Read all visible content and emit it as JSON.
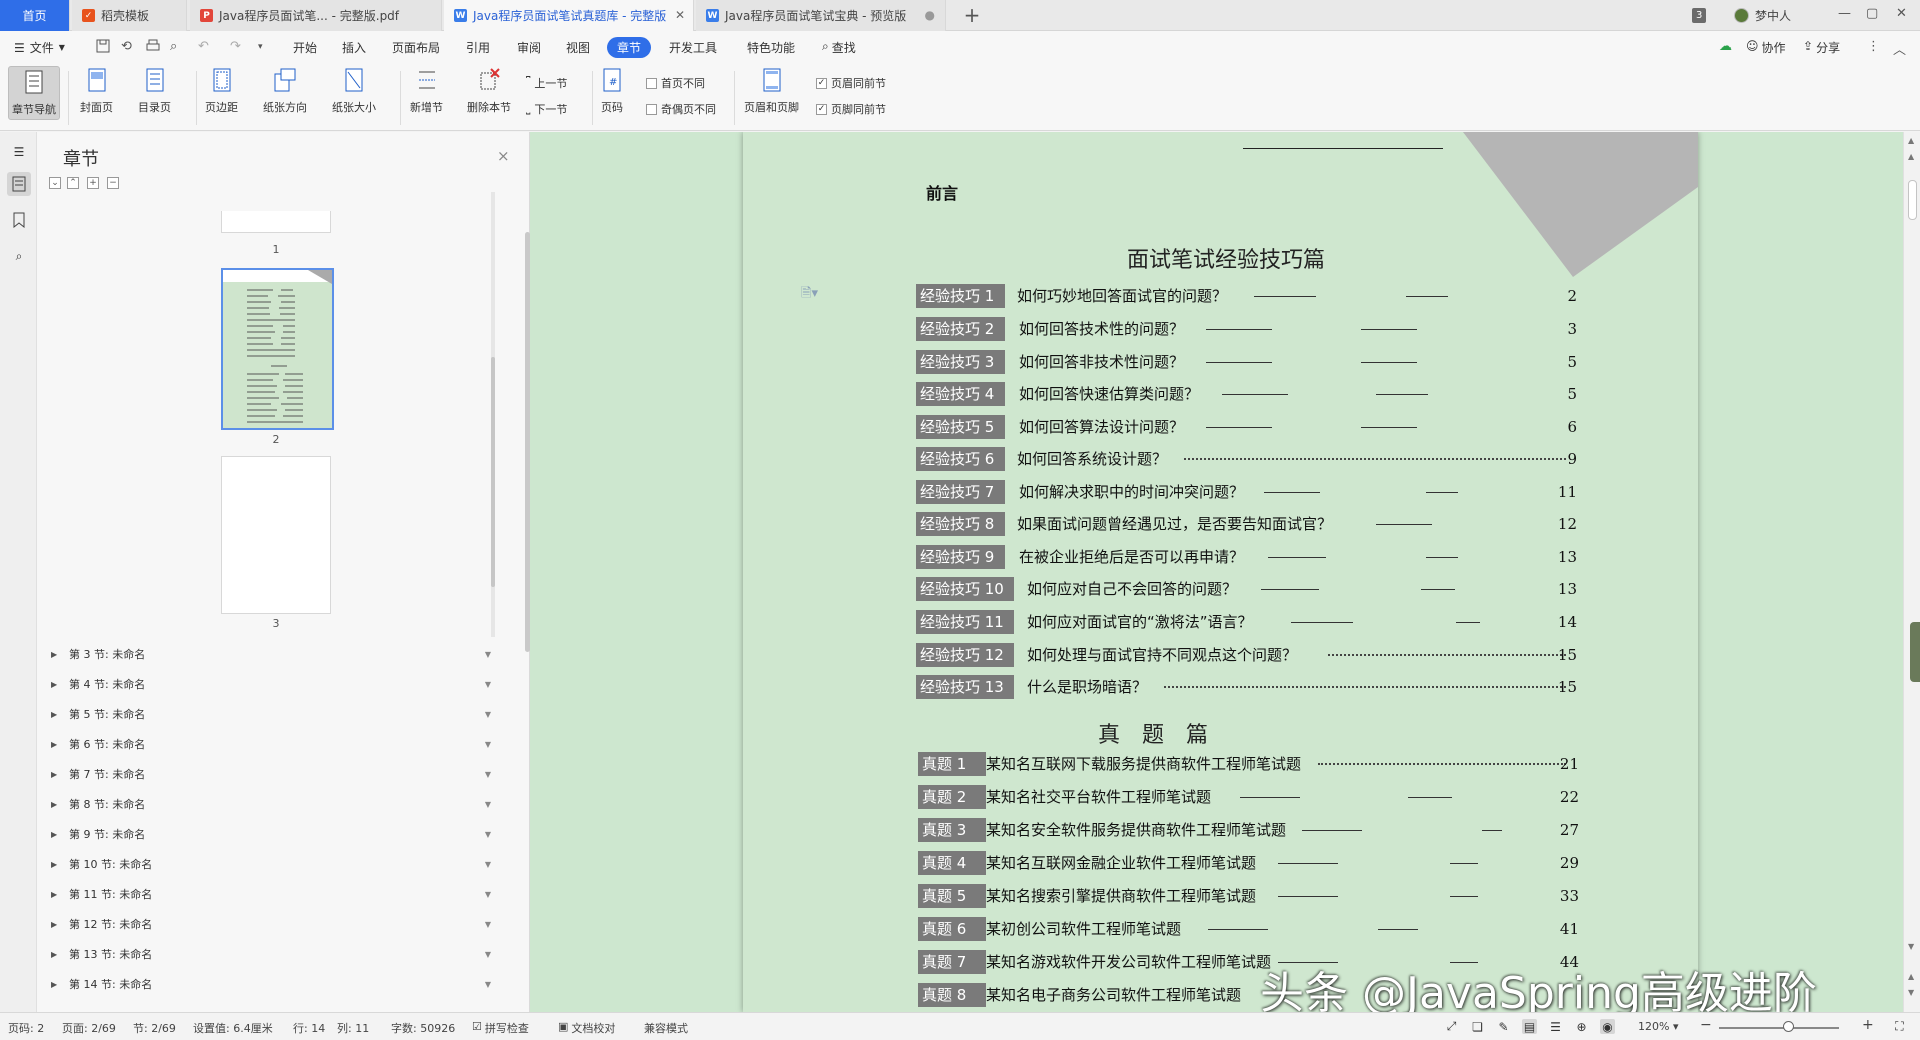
{
  "tabs": {
    "home": "首页",
    "docer": "稻壳模板",
    "pdf": "Java程序员面试笔... - 完整版.pdf",
    "doc_active": "Java程序员面试笔试真题库 - 完整版",
    "doc_preview": "Java程序员面试笔试宝典 - 预览版",
    "new_tab": "+"
  },
  "titlebar": {
    "badge": "3",
    "user": "梦中人",
    "minimize": "—",
    "restore": "▢",
    "close": "✕"
  },
  "menu": {
    "file": "文件",
    "items": [
      "开始",
      "插入",
      "页面布局",
      "引用",
      "审阅",
      "视图",
      "章节",
      "开发工具",
      "特色功能"
    ],
    "selected": "章节",
    "search": "查找",
    "collab": "协作",
    "share": "分享"
  },
  "ribbon": {
    "chapter_nav": "章节导航",
    "cover": "封面页",
    "toc_page": "目录页",
    "margin": "页边距",
    "orientation": "纸张方向",
    "size": "纸张大小",
    "new_section": "新增节",
    "delete_section": "删除本节",
    "prev_section": "上一节",
    "next_section": "下一节",
    "page_number": "页码",
    "first_page_diff": "首页不同",
    "odd_even_diff": "奇偶页不同",
    "header_footer": "页眉和页脚",
    "header_same": "页眉同前节",
    "footer_same": "页脚同前节"
  },
  "panel": {
    "title": "章节",
    "close": "×",
    "thumbs": [
      "1",
      "2",
      "3"
    ],
    "sections": [
      "第 3 节: 未命名",
      "第 4 节: 未命名",
      "第 5 节: 未命名",
      "第 6 节: 未命名",
      "第 7 节: 未命名",
      "第 8 节: 未命名",
      "第 9 节: 未命名",
      "第 10 节: 未命名",
      "第 11 节: 未命名",
      "第 12 节: 未命名",
      "第 13 节: 未命名",
      "第 14 节: 未命名"
    ]
  },
  "document": {
    "preface": "前言",
    "section1_title": "面试笔试经验技巧篇",
    "tips": [
      {
        "label": "经验技巧 1",
        "text": "如何巧妙地回答面试官的问题？",
        "page": "2"
      },
      {
        "label": "经验技巧 2",
        "text": "如何回答技术性的问题？",
        "page": "3"
      },
      {
        "label": "经验技巧 3",
        "text": "如何回答非技术性问题？",
        "page": "5"
      },
      {
        "label": "经验技巧 4",
        "text": "如何回答快速估算类问题？",
        "page": "5"
      },
      {
        "label": "经验技巧 5",
        "text": "如何回答算法设计问题？",
        "page": "6"
      },
      {
        "label": "经验技巧 6",
        "text": "如何回答系统设计题？",
        "page": "9"
      },
      {
        "label": "经验技巧 7",
        "text": "如何解决求职中的时间冲突问题？",
        "page": "11"
      },
      {
        "label": "经验技巧 8",
        "text": "如果面试问题曾经遇见过，是否要告知面试官？",
        "page": "12"
      },
      {
        "label": "经验技巧 9",
        "text": "在被企业拒绝后是否可以再申请？",
        "page": "13"
      },
      {
        "label": "经验技巧 10",
        "text": "如何应对自己不会回答的问题？",
        "page": "13"
      },
      {
        "label": "经验技巧 11",
        "text": "如何应对面试官的“激将法”语言？",
        "page": "14"
      },
      {
        "label": "经验技巧 12",
        "text": "如何处理与面试官持不同观点这个问题？",
        "page": "15"
      },
      {
        "label": "经验技巧 13",
        "text": "什么是职场暗语？",
        "page": "15"
      }
    ],
    "section2_title": "真　题　篇",
    "exams": [
      {
        "label": "真题 1",
        "text": "某知名互联网下载服务提供商软件工程师笔试题",
        "page": "21"
      },
      {
        "label": "真题 2",
        "text": "某知名社交平台软件工程师笔试题",
        "page": "22"
      },
      {
        "label": "真题 3",
        "text": "某知名安全软件服务提供商软件工程师笔试题",
        "page": "27"
      },
      {
        "label": "真题 4",
        "text": "某知名互联网金融企业软件工程师笔试题",
        "page": "29"
      },
      {
        "label": "真题 5",
        "text": "某知名搜索引擎提供商软件工程师笔试题",
        "page": "33"
      },
      {
        "label": "真题 6",
        "text": "某初创公司软件工程师笔试题",
        "page": "41"
      },
      {
        "label": "真题 7",
        "text": "某知名游戏软件开发公司软件工程师笔试题",
        "page": "44"
      },
      {
        "label": "真题 8",
        "text": "某知名电子商务公司软件工程师笔试题",
        "page": ""
      }
    ]
  },
  "watermark": "头条 @JavaSpring高级进阶",
  "status": {
    "page_code": "页码: 2",
    "page": "页面: 2/69",
    "section": "节: 2/69",
    "setting": "设置值: 6.4厘米",
    "row": "行: 14",
    "col": "列: 11",
    "words": "字数: 50926",
    "spell": "拼写检查",
    "proof": "文档校对",
    "compat": "兼容模式",
    "zoom": "120%"
  },
  "colors": {
    "accent": "#2f6ee8",
    "page_bg": "#cfe7cf",
    "label_bg": "#7a7a7a"
  }
}
